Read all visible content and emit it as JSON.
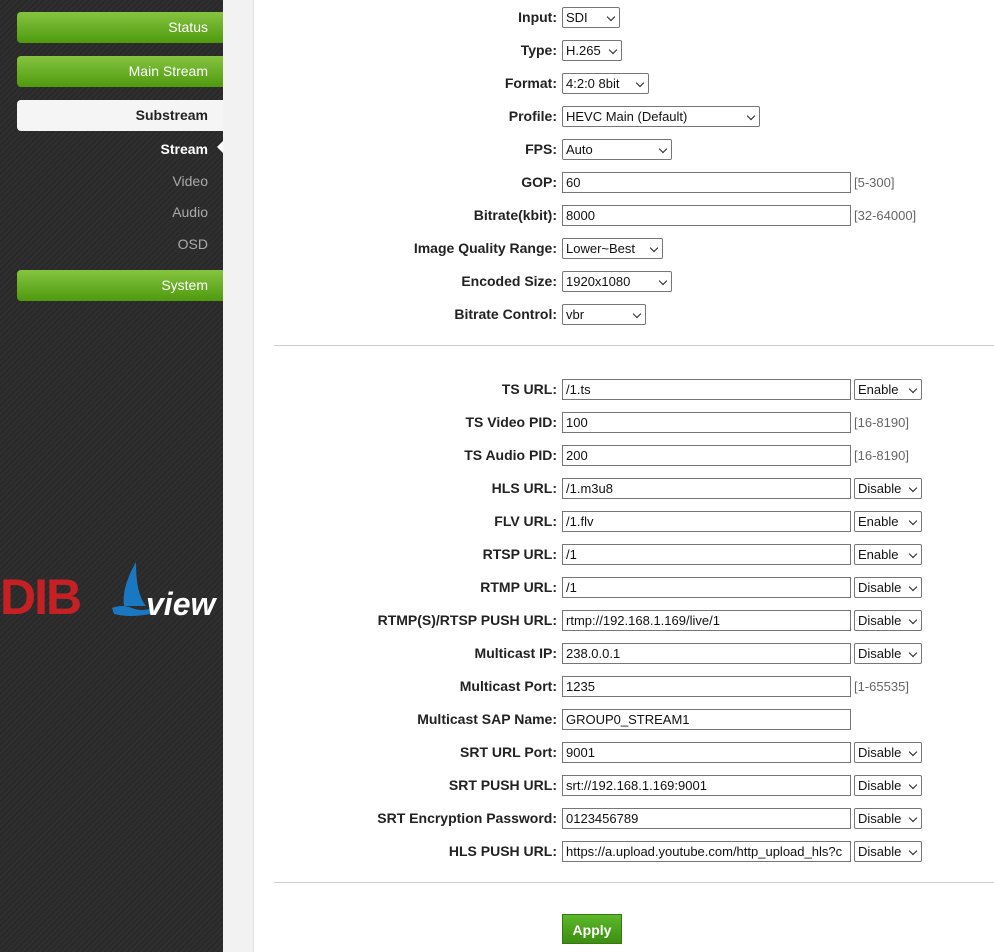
{
  "sidebar": {
    "status": "Status",
    "main_stream": "Main Stream",
    "substream": "Substream",
    "sub_items": [
      "Stream",
      "Video",
      "Audio",
      "OSD"
    ],
    "system": "System",
    "logo_left": "DIB",
    "logo_right": "view"
  },
  "stream": {
    "input": {
      "label": "Input:",
      "value": "SDI"
    },
    "type": {
      "label": "Type:",
      "value": "H.265"
    },
    "format": {
      "label": "Format:",
      "value": "4:2:0 8bit"
    },
    "profile": {
      "label": "Profile:",
      "value": "HEVC Main (Default)"
    },
    "fps": {
      "label": "FPS:",
      "value": "Auto"
    },
    "gop": {
      "label": "GOP:",
      "value": "60",
      "range": "[5-300]"
    },
    "bitrate": {
      "label": "Bitrate(kbit):",
      "value": "8000",
      "range": "[32-64000]"
    },
    "iqr": {
      "label": "Image Quality Range:",
      "value": "Lower~Best"
    },
    "encoded_size": {
      "label": "Encoded Size:",
      "value": "1920x1080"
    },
    "bitrate_control": {
      "label": "Bitrate Control:",
      "value": "vbr"
    }
  },
  "network": {
    "ts_url": {
      "label": "TS URL:",
      "value": "/1.ts",
      "state": "Enable"
    },
    "ts_video_pid": {
      "label": "TS Video PID:",
      "value": "100",
      "range": "[16-8190]"
    },
    "ts_audio_pid": {
      "label": "TS Audio PID:",
      "value": "200",
      "range": "[16-8190]"
    },
    "hls_url": {
      "label": "HLS URL:",
      "value": "/1.m3u8",
      "state": "Disable"
    },
    "flv_url": {
      "label": "FLV URL:",
      "value": "/1.flv",
      "state": "Enable"
    },
    "rtsp_url": {
      "label": "RTSP URL:",
      "value": "/1",
      "state": "Enable"
    },
    "rtmp_url": {
      "label": "RTMP URL:",
      "value": "/1",
      "state": "Disable"
    },
    "push_url": {
      "label": "RTMP(S)/RTSP PUSH URL:",
      "value": "rtmp://192.168.1.169/live/1",
      "state": "Disable"
    },
    "multicast_ip": {
      "label": "Multicast IP:",
      "value": "238.0.0.1",
      "state": "Disable"
    },
    "multicast_port": {
      "label": "Multicast Port:",
      "value": "1235",
      "range": "[1-65535]"
    },
    "sap_name": {
      "label": "Multicast SAP Name:",
      "value": "GROUP0_STREAM1"
    },
    "srt_port": {
      "label": "SRT URL Port:",
      "value": "9001",
      "state": "Disable"
    },
    "srt_push": {
      "label": "SRT PUSH URL:",
      "value": "srt://192.168.1.169:9001",
      "state": "Disable"
    },
    "srt_password": {
      "label": "SRT Encryption Password:",
      "value": "0123456789",
      "state": "Disable"
    },
    "hls_push": {
      "label": "HLS PUSH URL:",
      "value": "https://a.upload.youtube.com/http_upload_hls?c",
      "state": "Disable"
    }
  },
  "apply_label": "Apply"
}
